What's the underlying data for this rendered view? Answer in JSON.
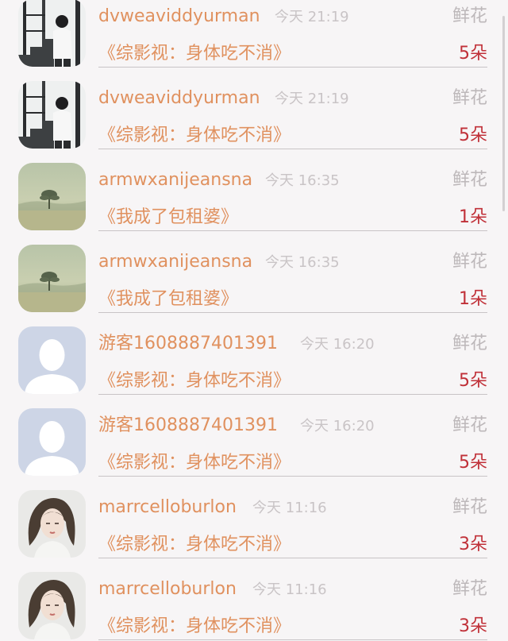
{
  "rows": [
    {
      "avatar": "person-stairs-avatar",
      "name": "dvweaviddyurman",
      "time": "今天 21:19",
      "gift": "鲜花",
      "title": "《综影视：身体吃不消》",
      "count": "5朵"
    },
    {
      "avatar": "person-stairs-avatar",
      "name": "dvweaviddyurman",
      "time": "今天 21:19",
      "gift": "鲜花",
      "title": "《综影视：身体吃不消》",
      "count": "5朵"
    },
    {
      "avatar": "landscape-tree-avatar",
      "name": "armwxanijeansna",
      "time": "今天 16:35",
      "gift": "鲜花",
      "title": "《我成了包租婆》",
      "count": "1朵"
    },
    {
      "avatar": "landscape-tree-avatar",
      "name": "armwxanijeansna",
      "time": "今天 16:35",
      "gift": "鲜花",
      "title": "《我成了包租婆》",
      "count": "1朵"
    },
    {
      "avatar": "default-user-avatar",
      "name": "游客1608887401391",
      "time": "今天 16:20",
      "gift": "鲜花",
      "title": "《综影视：身体吃不消》",
      "count": "5朵"
    },
    {
      "avatar": "default-user-avatar",
      "name": "游客1608887401391",
      "time": "今天 16:20",
      "gift": "鲜花",
      "title": "《综影视：身体吃不消》",
      "count": "5朵"
    },
    {
      "avatar": "woman-portrait-avatar",
      "name": "marrcelloburlon",
      "time": "今天 11:16",
      "gift": "鲜花",
      "title": "《综影视：身体吃不消》",
      "count": "3朵"
    },
    {
      "avatar": "woman-portrait-avatar",
      "name": "marrcelloburlon",
      "time": "今天 11:16",
      "gift": "鲜花",
      "title": "《综影视：身体吃不消》",
      "count": "3朵"
    }
  ]
}
